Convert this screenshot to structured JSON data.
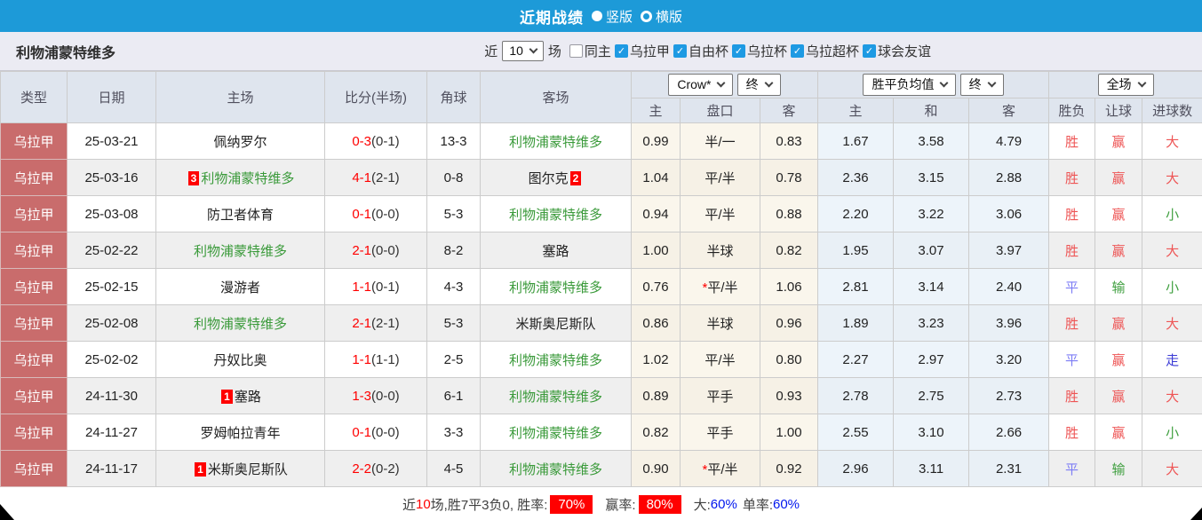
{
  "titlebar": {
    "title": "近期战绩",
    "radios": [
      {
        "label": "竖版",
        "selected": true
      },
      {
        "label": "横版",
        "selected": false
      }
    ]
  },
  "filterbar": {
    "team": "利物浦蒙特维多",
    "near_label": "近",
    "games_count": "10",
    "games_label": "场",
    "checkboxes": [
      {
        "label": "同主",
        "checked": false
      },
      {
        "label": "乌拉甲",
        "checked": true
      },
      {
        "label": "自由杯",
        "checked": true
      },
      {
        "label": "乌拉杯",
        "checked": true
      },
      {
        "label": "乌拉超杯",
        "checked": true
      },
      {
        "label": "球会友谊",
        "checked": true
      }
    ]
  },
  "header": {
    "cols": [
      "类型",
      "日期",
      "主场",
      "比分(半场)",
      "角球",
      "客场"
    ],
    "selects": {
      "bookmaker": "Crow*",
      "bookmaker_period": "终",
      "europe": "胜平负均值",
      "europe_period": "终",
      "scope": "全场"
    },
    "sub": [
      "主",
      "盘口",
      "客",
      "主",
      "和",
      "客",
      "胜负",
      "让球",
      "进球数"
    ]
  },
  "rows": [
    {
      "league": "乌拉甲",
      "date": "25-03-21",
      "home": {
        "card": "",
        "name": "佩纳罗尔",
        "self": false
      },
      "score": "0-3",
      "half": "(0-1)",
      "corner": "13-3",
      "away": {
        "card": "",
        "name": "利物浦蒙特维多",
        "self": true
      },
      "asia": {
        "home": "0.99",
        "star": "",
        "line": "半/一",
        "away": "0.83"
      },
      "euro": {
        "home": "1.67",
        "draw": "3.58",
        "away": "4.79"
      },
      "outcome": "胜",
      "handicap_result": "赢",
      "goals": "大"
    },
    {
      "league": "乌拉甲",
      "date": "25-03-16",
      "home": {
        "card": "3",
        "name": "利物浦蒙特维多",
        "self": true
      },
      "score": "4-1",
      "half": "(2-1)",
      "corner": "0-8",
      "away": {
        "card": "2",
        "name": "图尔克",
        "self": false
      },
      "asia": {
        "home": "1.04",
        "star": "",
        "line": "平/半",
        "away": "0.78"
      },
      "euro": {
        "home": "2.36",
        "draw": "3.15",
        "away": "2.88"
      },
      "outcome": "胜",
      "handicap_result": "赢",
      "goals": "大"
    },
    {
      "league": "乌拉甲",
      "date": "25-03-08",
      "home": {
        "card": "",
        "name": "防卫者体育",
        "self": false
      },
      "score": "0-1",
      "half": "(0-0)",
      "corner": "5-3",
      "away": {
        "card": "",
        "name": "利物浦蒙特维多",
        "self": true
      },
      "asia": {
        "home": "0.94",
        "star": "",
        "line": "平/半",
        "away": "0.88"
      },
      "euro": {
        "home": "2.20",
        "draw": "3.22",
        "away": "3.06"
      },
      "outcome": "胜",
      "handicap_result": "赢",
      "goals": "小"
    },
    {
      "league": "乌拉甲",
      "date": "25-02-22",
      "home": {
        "card": "",
        "name": "利物浦蒙特维多",
        "self": true
      },
      "score": "2-1",
      "half": "(0-0)",
      "corner": "8-2",
      "away": {
        "card": "",
        "name": "塞路",
        "self": false
      },
      "asia": {
        "home": "1.00",
        "star": "",
        "line": "半球",
        "away": "0.82"
      },
      "euro": {
        "home": "1.95",
        "draw": "3.07",
        "away": "3.97"
      },
      "outcome": "胜",
      "handicap_result": "赢",
      "goals": "大"
    },
    {
      "league": "乌拉甲",
      "date": "25-02-15",
      "home": {
        "card": "",
        "name": "漫游者",
        "self": false
      },
      "score": "1-1",
      "half": "(0-1)",
      "corner": "4-3",
      "away": {
        "card": "",
        "name": "利物浦蒙特维多",
        "self": true
      },
      "asia": {
        "home": "0.76",
        "star": "*",
        "line": "平/半",
        "away": "1.06"
      },
      "euro": {
        "home": "2.81",
        "draw": "3.14",
        "away": "2.40"
      },
      "outcome": "平",
      "handicap_result": "输",
      "goals": "小"
    },
    {
      "league": "乌拉甲",
      "date": "25-02-08",
      "home": {
        "card": "",
        "name": "利物浦蒙特维多",
        "self": true
      },
      "score": "2-1",
      "half": "(2-1)",
      "corner": "5-3",
      "away": {
        "card": "",
        "name": "米斯奥尼斯队",
        "self": false
      },
      "asia": {
        "home": "0.86",
        "star": "",
        "line": "半球",
        "away": "0.96"
      },
      "euro": {
        "home": "1.89",
        "draw": "3.23",
        "away": "3.96"
      },
      "outcome": "胜",
      "handicap_result": "赢",
      "goals": "大"
    },
    {
      "league": "乌拉甲",
      "date": "25-02-02",
      "home": {
        "card": "",
        "name": "丹奴比奥",
        "self": false
      },
      "score": "1-1",
      "half": "(1-1)",
      "corner": "2-5",
      "away": {
        "card": "",
        "name": "利物浦蒙特维多",
        "self": true
      },
      "asia": {
        "home": "1.02",
        "star": "",
        "line": "平/半",
        "away": "0.80"
      },
      "euro": {
        "home": "2.27",
        "draw": "2.97",
        "away": "3.20"
      },
      "outcome": "平",
      "handicap_result": "赢",
      "goals": "走"
    },
    {
      "league": "乌拉甲",
      "date": "24-11-30",
      "home": {
        "card": "1",
        "name": "塞路",
        "self": false
      },
      "score": "1-3",
      "half": "(0-0)",
      "corner": "6-1",
      "away": {
        "card": "",
        "name": "利物浦蒙特维多",
        "self": true
      },
      "asia": {
        "home": "0.89",
        "star": "",
        "line": "平手",
        "away": "0.93"
      },
      "euro": {
        "home": "2.78",
        "draw": "2.75",
        "away": "2.73"
      },
      "outcome": "胜",
      "handicap_result": "赢",
      "goals": "大"
    },
    {
      "league": "乌拉甲",
      "date": "24-11-27",
      "home": {
        "card": "",
        "name": "罗姆帕拉青年",
        "self": false
      },
      "score": "0-1",
      "half": "(0-0)",
      "corner": "3-3",
      "away": {
        "card": "",
        "name": "利物浦蒙特维多",
        "self": true
      },
      "asia": {
        "home": "0.82",
        "star": "",
        "line": "平手",
        "away": "1.00"
      },
      "euro": {
        "home": "2.55",
        "draw": "3.10",
        "away": "2.66"
      },
      "outcome": "胜",
      "handicap_result": "赢",
      "goals": "小"
    },
    {
      "league": "乌拉甲",
      "date": "24-11-17",
      "home": {
        "card": "1",
        "name": "米斯奥尼斯队",
        "self": false
      },
      "score": "2-2",
      "half": "(0-2)",
      "corner": "4-5",
      "away": {
        "card": "",
        "name": "利物浦蒙特维多",
        "self": true
      },
      "asia": {
        "home": "0.90",
        "star": "*",
        "line": "平/半",
        "away": "0.92"
      },
      "euro": {
        "home": "2.96",
        "draw": "3.11",
        "away": "2.31"
      },
      "outcome": "平",
      "handicap_result": "输",
      "goals": "大"
    }
  ],
  "footer": {
    "near": "近",
    "count": "10",
    "stats": "场,胜7平3负0, 胜率:",
    "win_rate": "70%",
    "win_label": "赢率:",
    "win_pct": "80%",
    "big_label": "大:",
    "big_pct": "60%",
    "single_label": "单率:",
    "single_pct": "60%"
  },
  "colors": {
    "titlebar_blue": "#1d9ad8",
    "checkbox_blue": "#1e9ae3",
    "league_red": "#c96c6c",
    "self_team_green": "#3a9a3a",
    "score_red": "#ff0000",
    "card_badge_red": "#ff0000",
    "rate_badge_red": "#ff0000",
    "value_blue": "#0016ee",
    "asia_col_bg": "#faf6ec",
    "euro_col_bg": "#edf4fa"
  }
}
